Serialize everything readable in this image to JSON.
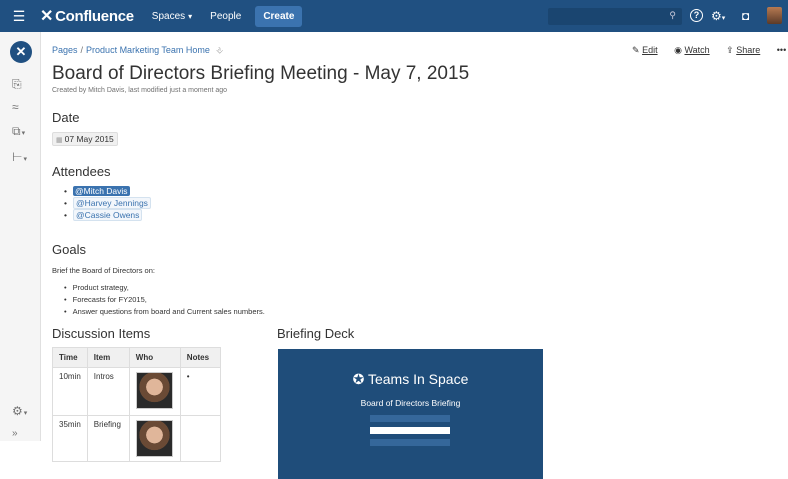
{
  "topnav": {
    "brand": "Confluence",
    "spaces": "Spaces",
    "people": "People",
    "create": "Create"
  },
  "page": {
    "breadcrumb": [
      "Pages",
      "Product Marketing Team Home"
    ],
    "actions": {
      "edit": "Edit",
      "watch": "Watch",
      "share": "Share",
      "more": "•••"
    },
    "title": "Board of Directors Briefing Meeting - May 7, 2015",
    "byline": "Created by Mitch Davis, last modified just a moment ago"
  },
  "date_section": {
    "heading": "Date",
    "date": "07 May 2015"
  },
  "attendees": {
    "heading": "Attendees",
    "people": [
      {
        "name": "@Mitch Davis"
      },
      {
        "name": "@Harvey Jennings"
      },
      {
        "name": "@Cassie Owens"
      }
    ]
  },
  "goals": {
    "heading": "Goals",
    "intro": "Brief the Board of Directors on:",
    "items": [
      "Product strategy,",
      "Forecasts for FY2015,",
      "Answer questions from board and Current sales numbers."
    ]
  },
  "discussion": {
    "heading": "Discussion Items",
    "columns": [
      "Time",
      "Item",
      "Who",
      "Notes"
    ],
    "rows": [
      {
        "time": "10min",
        "item": "Intros",
        "notes": "•"
      },
      {
        "time": "35min",
        "item": "Briefing",
        "notes": ""
      }
    ]
  },
  "deck": {
    "heading": "Briefing Deck",
    "brand": "Teams In Space",
    "subtitle": "Board of Directors Briefing"
  }
}
